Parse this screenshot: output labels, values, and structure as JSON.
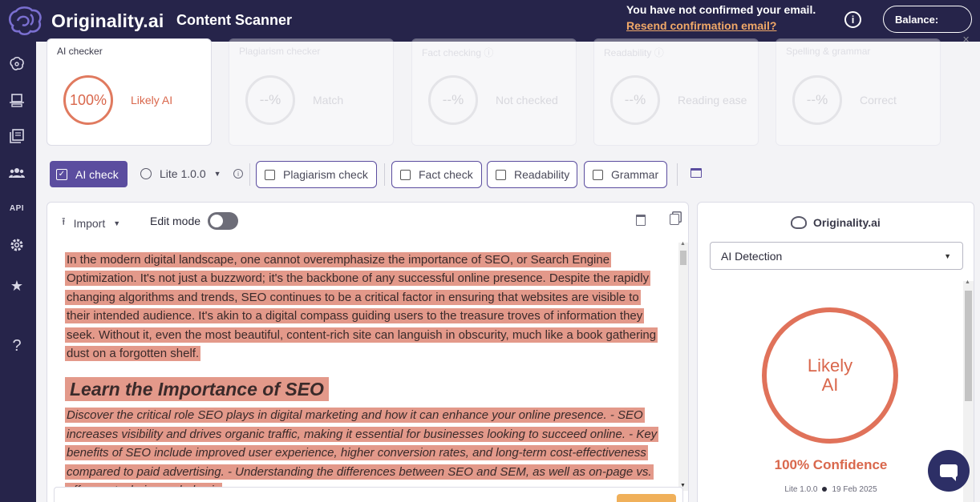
{
  "topbar": {
    "brand": "Originality.ai",
    "app_title": "Content Scanner",
    "notice_message": "You have not confirmed your email.",
    "notice_link": "Resend confirmation email?",
    "balance_label": "Balance:"
  },
  "sidebar": {
    "items": [
      {
        "icon": "brain-icon"
      },
      {
        "icon": "scanner-icon"
      },
      {
        "icon": "library-icon"
      },
      {
        "icon": "team-icon"
      },
      {
        "icon": "api-icon",
        "label": "API"
      },
      {
        "icon": "gear-icon"
      },
      {
        "icon": "star-icon"
      },
      {
        "icon": "help-icon",
        "label": "?"
      }
    ]
  },
  "cards": [
    {
      "title": "AI checker",
      "value": "100%",
      "label": "Likely AI",
      "active": true
    },
    {
      "title": "Plagiarism checker",
      "value": "--%",
      "label": "Match",
      "active": false
    },
    {
      "title": "Fact checking ⓘ",
      "value": "--%",
      "label": "Not checked",
      "active": false
    },
    {
      "title": "Readability ⓘ",
      "value": "--%",
      "label": "Reading ease",
      "active": false
    },
    {
      "title": "Spelling & grammar",
      "value": "--%",
      "label": "Correct",
      "active": false
    }
  ],
  "toolbar": {
    "ai_check": "AI check",
    "model": "Lite 1.0.0",
    "plagiarism": "Plagiarism check",
    "fact": "Fact check",
    "readability": "Readability",
    "grammar": "Grammar"
  },
  "editor": {
    "import_label": "Import",
    "edit_mode_label": "Edit mode",
    "paragraph1": "In the modern digital landscape, one cannot overemphasize the importance of SEO, or Search Engine Optimization.  It's not just a buzzword; it's the backbone of any successful online presence.  Despite the rapidly changing algorithms and trends, SEO continues to be a critical factor in ensuring that websites are visible to their intended audience.  It's akin to a digital compass guiding users to the treasure troves of information they seek.  Without it, even the most beautiful, content-rich site can languish in obscurity, much like a book gathering dust on a forgotten shelf.",
    "heading": "Learn the Importance of SEO",
    "paragraph2": "Discover the critical role SEO plays in digital marketing and how it can enhance your online presence. - SEO increases visibility and drives organic traffic, making it essential for businesses looking to succeed online. - Key benefits of SEO include improved user experience, higher conversion rates, and long-term cost-effectiveness compared to paid advertising. - Understanding the differences between SEO and SEM, as well as on-page vs. off-page techniques, helps in"
  },
  "result": {
    "brand": "Originality.ai",
    "select_value": "AI Detection",
    "ring_text": "Likely AI",
    "confidence": "100% Confidence",
    "model": "Lite 1.0.0",
    "date": "19 Feb 2025"
  },
  "colors": {
    "navy": "#26244a",
    "accent_purple": "#5b4d9f",
    "ai_red": "#e0725a",
    "highlight": "#e3998a",
    "link_orange": "#f0a868"
  }
}
